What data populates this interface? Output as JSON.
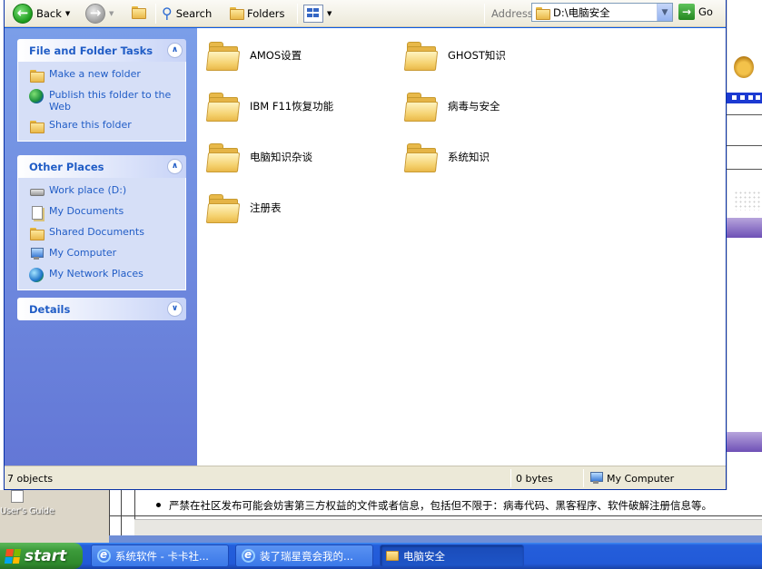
{
  "toolbar": {
    "back_label": "Back",
    "search_label": "Search",
    "folders_label": "Folders",
    "address_label": "Address",
    "address_value": "D:\\电脑安全",
    "go_label": "Go"
  },
  "sidebar": {
    "file_tasks": {
      "title": "File and Folder Tasks",
      "items": [
        {
          "label": "Make a new folder",
          "icon": "new-folder-icon"
        },
        {
          "label": "Publish this folder to the Web",
          "icon": "publish-web-icon"
        },
        {
          "label": "Share this folder",
          "icon": "share-folder-icon"
        }
      ]
    },
    "other_places": {
      "title": "Other Places",
      "items": [
        {
          "label": "Work place (D:)",
          "icon": "drive-icon"
        },
        {
          "label": "My Documents",
          "icon": "documents-icon"
        },
        {
          "label": "Shared Documents",
          "icon": "folder-icon"
        },
        {
          "label": "My Computer",
          "icon": "computer-icon"
        },
        {
          "label": "My Network Places",
          "icon": "network-icon"
        }
      ]
    },
    "details": {
      "title": "Details"
    }
  },
  "folders": [
    {
      "name": "AMOS设置"
    },
    {
      "name": "GHOST知识"
    },
    {
      "name": "IBM F11恢复功能"
    },
    {
      "name": "病毒与安全"
    },
    {
      "name": "电脑知识杂谈"
    },
    {
      "name": "系统知识"
    },
    {
      "name": "注册表"
    }
  ],
  "status": {
    "objects": "7 objects",
    "size": "0 bytes",
    "location": "My Computer"
  },
  "background": {
    "desktop_label": "User's Guide",
    "notice": "严禁在社区发布可能会妨害第三方权益的文件或者信息，包括但不限于：病毒代码、黑客程序、软件破解注册信息等。"
  },
  "taskbar": {
    "start_label": "start",
    "tasks": [
      {
        "label": "系统软件 - 卡卡社...",
        "icon": "ie-icon",
        "active": false
      },
      {
        "label": "装了瑞星竟会我的...",
        "icon": "ie-icon",
        "active": false
      },
      {
        "label": "电脑安全",
        "icon": "folder-icon",
        "active": true
      }
    ]
  },
  "colors": {
    "task_pane_top": "#7b9ee8",
    "task_pane_bottom": "#6377d6",
    "link_blue": "#215dc6",
    "taskbar_blue": "#245edb",
    "start_green": "#3c9a3a"
  }
}
